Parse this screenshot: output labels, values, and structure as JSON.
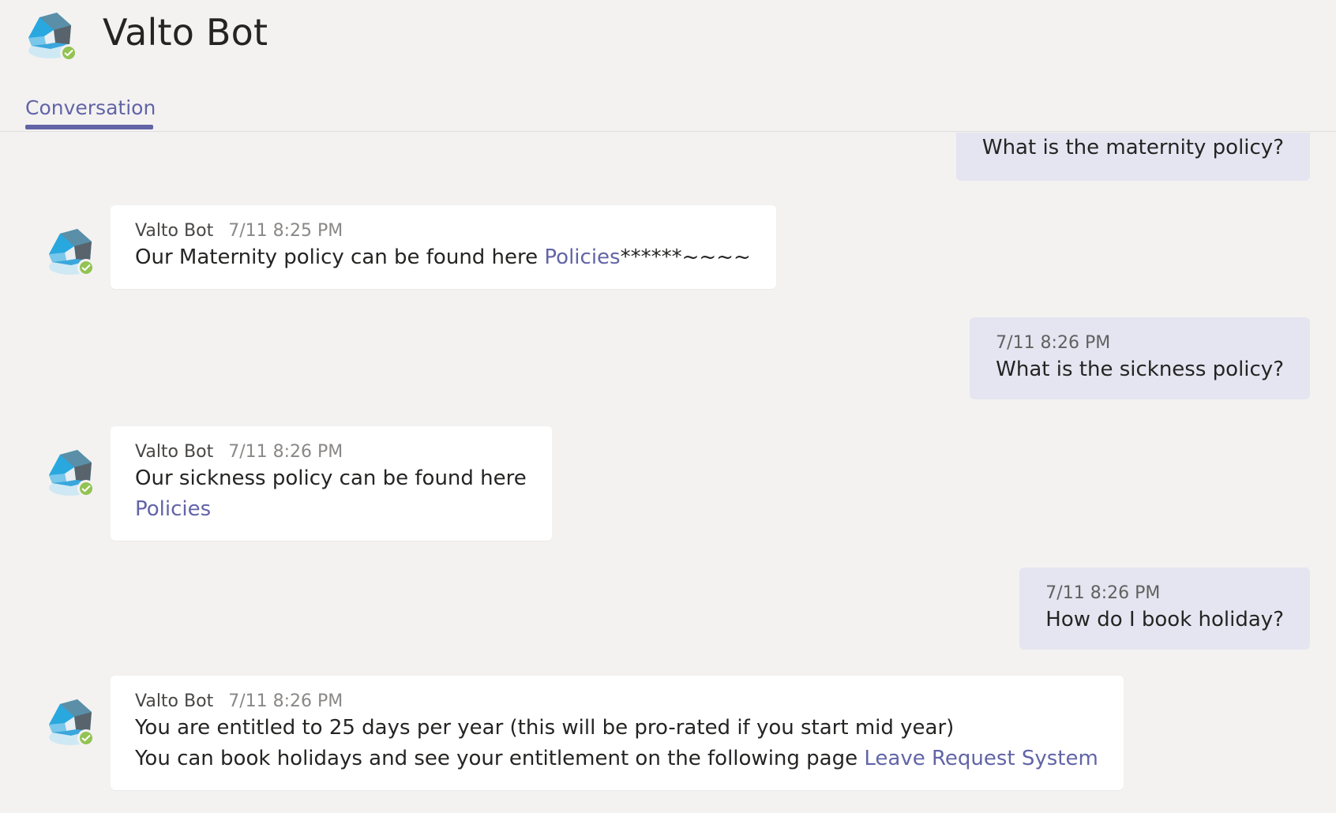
{
  "header": {
    "title": "Valto Bot",
    "tabs": [
      {
        "label": "Conversation",
        "active": true
      }
    ]
  },
  "colors": {
    "accent": "#6264a7",
    "background": "#f3f2f1",
    "user_bubble": "#e5e5f1",
    "bot_bubble": "#ffffff",
    "presence_available": "#92c353"
  },
  "messages": [
    {
      "from": "user",
      "time": "",
      "text": "What is the maternity policy?"
    },
    {
      "from": "bot",
      "sender": "Valto Bot",
      "time": "7/11 8:25 PM",
      "text_before": "Our Maternity policy can be found here ",
      "link": "Policies",
      "text_after": "******~~~~"
    },
    {
      "from": "user",
      "time": "7/11 8:26 PM",
      "text": "What is the sickness policy?"
    },
    {
      "from": "bot",
      "sender": "Valto Bot",
      "time": "7/11 8:26 PM",
      "text": "Our sickness policy can be found here",
      "link": "Policies"
    },
    {
      "from": "user",
      "time": "7/11 8:26 PM",
      "text": "How do I book holiday?"
    },
    {
      "from": "bot",
      "sender": "Valto Bot",
      "time": "7/11 8:26 PM",
      "line1": "You are entitled to 25 days per year (this will be pro-rated if you start mid year)",
      "line2_before": "You can book holidays and see your entitlement on the following page ",
      "link": "Leave Request System"
    }
  ]
}
